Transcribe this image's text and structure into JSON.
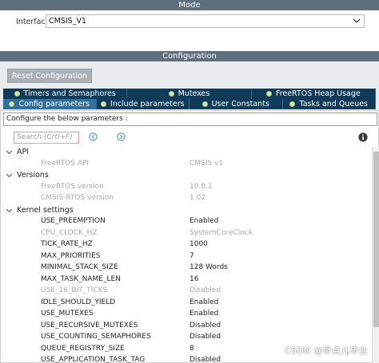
{
  "mode": {
    "header": "Mode",
    "interface_label": "Interface",
    "interface_value": "CMSIS_V1"
  },
  "configuration": {
    "header": "Configuration",
    "reset_label": "Reset Configuration",
    "tabs_row1": [
      {
        "label": "Timers and Semaphores"
      },
      {
        "label": "Mutexes"
      },
      {
        "label": "FreeRTOS Heap Usage"
      }
    ],
    "tabs_row2": [
      {
        "label": "Config parameters",
        "active": true
      },
      {
        "label": "Include parameters"
      },
      {
        "label": "User Constants"
      },
      {
        "label": "Tasks and Queues"
      }
    ],
    "hint": "Configure the below parameters :",
    "search_placeholder": "Search (Crtl+F)"
  },
  "groups": {
    "api": {
      "name": "API",
      "params": [
        {
          "name": "FreeRTOS API",
          "value": "CMSIS v1"
        }
      ]
    },
    "versions": {
      "name": "Versions",
      "params": [
        {
          "name": "FreeRTOS version",
          "value": "10.0.1"
        },
        {
          "name": "CMSIS-RTOS version",
          "value": "1.02"
        }
      ]
    },
    "kernel": {
      "name": "Kernel settings",
      "params": [
        {
          "name": "USE_PREEMPTION",
          "value": "Enabled"
        },
        {
          "name": "CPU_CLOCK_HZ",
          "value": "SystemCoreClock"
        },
        {
          "name": "TICK_RATE_HZ",
          "value": "1000"
        },
        {
          "name": "MAX_PRIORITIES",
          "value": "7"
        },
        {
          "name": "MINIMAL_STACK_SIZE",
          "value": "128 Words"
        },
        {
          "name": "MAX_TASK_NAME_LEN",
          "value": "16"
        },
        {
          "name": "USE_16_BIT_TICKS",
          "value": "Disabled"
        },
        {
          "name": "IDLE_SHOULD_YIELD",
          "value": "Enabled"
        },
        {
          "name": "USE_MUTEXES",
          "value": "Enabled"
        },
        {
          "name": "USE_RECURSIVE_MUTEXES",
          "value": "Disabled"
        },
        {
          "name": "USE_COUNTING_SEMAPHORES",
          "value": "Disabled"
        },
        {
          "name": "QUEUE_REGISTRY_SIZE",
          "value": "8"
        },
        {
          "name": "USE_APPLICATION_TASK_TAG",
          "value": "Disabled"
        }
      ]
    }
  },
  "watermark": "CSDN @早点儿毕业",
  "colors": {
    "section_bar": "#5f6f7b",
    "tab_bg": "#103b58",
    "tab_active": "#2e6f9e",
    "tab_dot": "#d7e8b0",
    "muted_text": "#a8a8a8"
  },
  "icons": [
    "chevron-down-icon",
    "expand-all-icon",
    "collapse-all-icon",
    "info-icon"
  ]
}
